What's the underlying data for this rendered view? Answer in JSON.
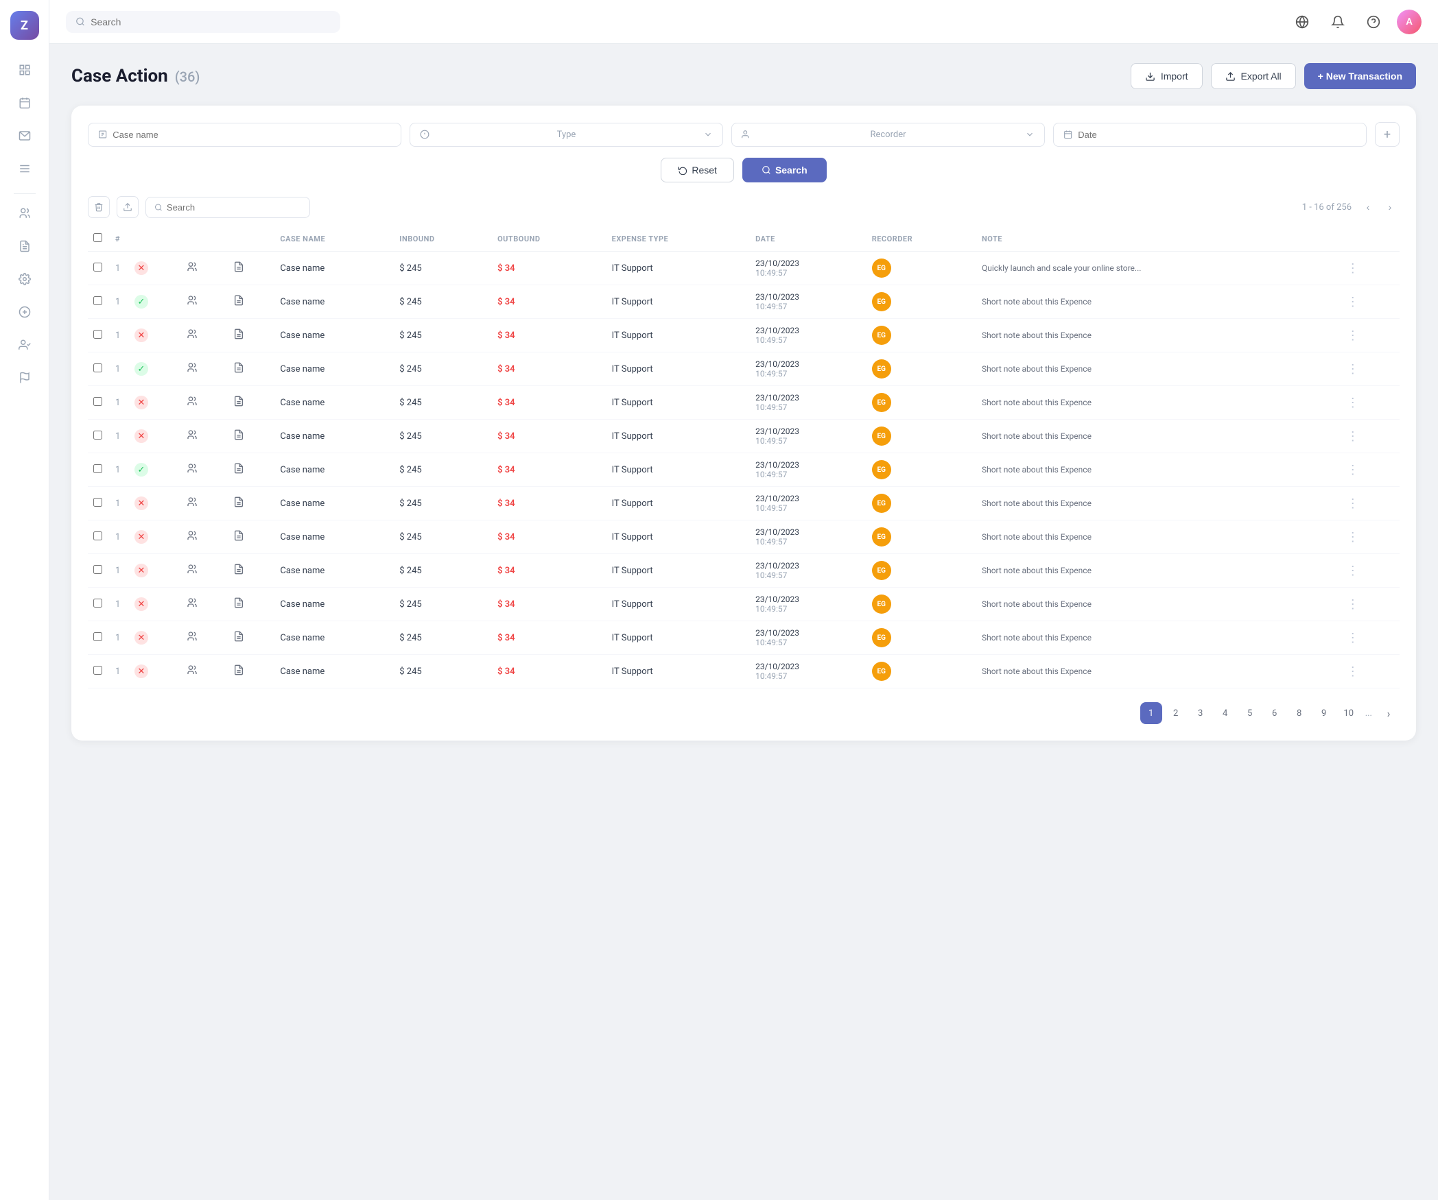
{
  "app": {
    "logo_text": "Z",
    "search_placeholder": "Search"
  },
  "nav": {
    "globe_icon": "🌐",
    "bell_icon": "🔔",
    "help_icon": "❓"
  },
  "page": {
    "title": "Case Action",
    "count": "(36)",
    "import_label": "Import",
    "export_label": "Export All",
    "new_transaction_label": "+ New Transaction"
  },
  "filters": {
    "case_name_placeholder": "Case name",
    "type_placeholder": "Type",
    "recorder_placeholder": "Recorder",
    "date_placeholder": "Date",
    "reset_label": "Reset",
    "search_label": "Search"
  },
  "table": {
    "search_placeholder": "Search",
    "pagination_info": "1 - 16 of 256",
    "columns": [
      "",
      "#",
      "",
      "",
      "",
      "CASE NAME",
      "INBOUND",
      "OUTBOUND",
      "EXPENSE TYPE",
      "DATE",
      "RECORDER",
      "NOTE",
      ""
    ],
    "rows": [
      {
        "num": 1,
        "status": "red",
        "case_name": "Case name",
        "inbound": "$ 245",
        "outbound": "$ 34",
        "expense_type": "IT Support",
        "date": "23/10/2023",
        "time": "10:49:57",
        "recorder": "EG",
        "note": "Quickly launch and scale your online store..."
      },
      {
        "num": 1,
        "status": "green",
        "case_name": "Case name",
        "inbound": "$ 245",
        "outbound": "$ 34",
        "expense_type": "IT Support",
        "date": "23/10/2023",
        "time": "10:49:57",
        "recorder": "EG",
        "note": "Short note about this Expence"
      },
      {
        "num": 1,
        "status": "red",
        "case_name": "Case name",
        "inbound": "$ 245",
        "outbound": "$ 34",
        "expense_type": "IT Support",
        "date": "23/10/2023",
        "time": "10:49:57",
        "recorder": "EG",
        "note": "Short note about this Expence"
      },
      {
        "num": 1,
        "status": "green",
        "case_name": "Case name",
        "inbound": "$ 245",
        "outbound": "$ 34",
        "expense_type": "IT Support",
        "date": "23/10/2023",
        "time": "10:49:57",
        "recorder": "EG",
        "note": "Short note about this Expence"
      },
      {
        "num": 1,
        "status": "red",
        "case_name": "Case name",
        "inbound": "$ 245",
        "outbound": "$ 34",
        "expense_type": "IT Support",
        "date": "23/10/2023",
        "time": "10:49:57",
        "recorder": "EG",
        "note": "Short note about this Expence"
      },
      {
        "num": 1,
        "status": "red",
        "case_name": "Case name",
        "inbound": "$ 245",
        "outbound": "$ 34",
        "expense_type": "IT Support",
        "date": "23/10/2023",
        "time": "10:49:57",
        "recorder": "EG",
        "note": "Short note about this Expence"
      },
      {
        "num": 1,
        "status": "green",
        "case_name": "Case name",
        "inbound": "$ 245",
        "outbound": "$ 34",
        "expense_type": "IT Support",
        "date": "23/10/2023",
        "time": "10:49:57",
        "recorder": "EG",
        "note": "Short note about this Expence"
      },
      {
        "num": 1,
        "status": "red",
        "case_name": "Case name",
        "inbound": "$ 245",
        "outbound": "$ 34",
        "expense_type": "IT Support",
        "date": "23/10/2023",
        "time": "10:49:57",
        "recorder": "EG",
        "note": "Short note about this Expence"
      },
      {
        "num": 1,
        "status": "red",
        "case_name": "Case name",
        "inbound": "$ 245",
        "outbound": "$ 34",
        "expense_type": "IT Support",
        "date": "23/10/2023",
        "time": "10:49:57",
        "recorder": "EG",
        "note": "Short note about this Expence"
      },
      {
        "num": 1,
        "status": "red",
        "case_name": "Case name",
        "inbound": "$ 245",
        "outbound": "$ 34",
        "expense_type": "IT Support",
        "date": "23/10/2023",
        "time": "10:49:57",
        "recorder": "EG",
        "note": "Short note about this Expence"
      },
      {
        "num": 1,
        "status": "red",
        "case_name": "Case name",
        "inbound": "$ 245",
        "outbound": "$ 34",
        "expense_type": "IT Support",
        "date": "23/10/2023",
        "time": "10:49:57",
        "recorder": "EG",
        "note": "Short note about this Expence"
      },
      {
        "num": 1,
        "status": "red",
        "case_name": "Case name",
        "inbound": "$ 245",
        "outbound": "$ 34",
        "expense_type": "IT Support",
        "date": "23/10/2023",
        "time": "10:49:57",
        "recorder": "EG",
        "note": "Short note about this Expence"
      },
      {
        "num": 1,
        "status": "red",
        "case_name": "Case name",
        "inbound": "$ 245",
        "outbound": "$ 34",
        "expense_type": "IT Support",
        "date": "23/10/2023",
        "time": "10:49:57",
        "recorder": "EG",
        "note": "Short note about this Expence"
      }
    ],
    "pages": [
      "1",
      "2",
      "3",
      "4",
      "5",
      "6",
      "8",
      "9",
      "10"
    ]
  },
  "sidebar": {
    "icons": [
      {
        "name": "grid-icon",
        "symbol": "⊞",
        "active": false
      },
      {
        "name": "calendar-icon",
        "symbol": "📅",
        "active": false
      },
      {
        "name": "mail-icon",
        "symbol": "✉",
        "active": false
      },
      {
        "name": "list-icon",
        "symbol": "☰",
        "active": false
      },
      {
        "name": "people-icon",
        "symbol": "👥",
        "active": false
      },
      {
        "name": "document-icon",
        "symbol": "📄",
        "active": false
      },
      {
        "name": "settings-icon",
        "symbol": "⚙",
        "active": false
      },
      {
        "name": "dollar-icon",
        "symbol": "$",
        "active": false
      },
      {
        "name": "user-check-icon",
        "symbol": "👤",
        "active": false
      },
      {
        "name": "flag-icon",
        "symbol": "⚑",
        "active": false
      }
    ]
  }
}
